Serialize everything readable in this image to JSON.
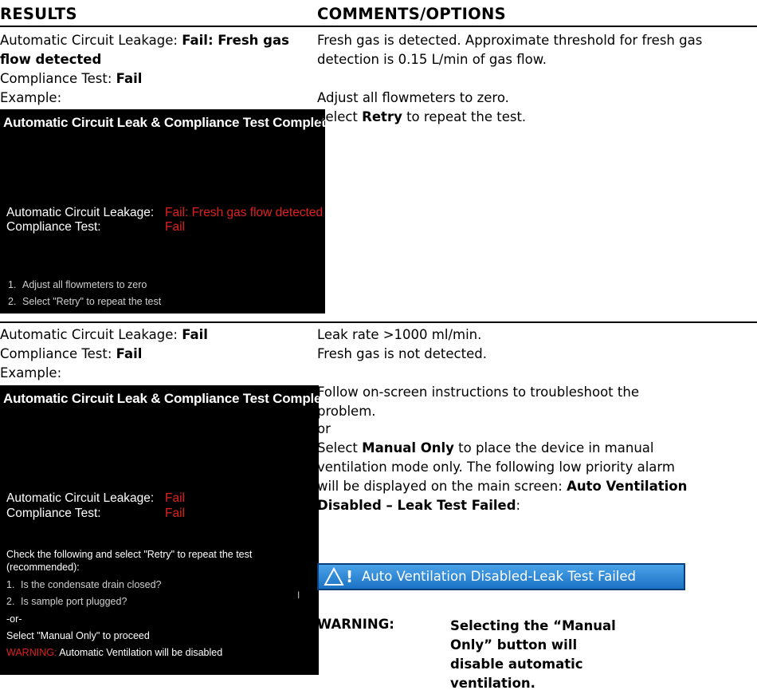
{
  "header": {
    "results": "RESULTS",
    "comments": "COMMENTS/OPTIONS"
  },
  "row1": {
    "result_line1_label": "Automatic Circuit Leakage: ",
    "result_line1_value_a": "Fail: Fresh gas",
    "result_line1_value_b": "flow detected",
    "result_line2_label": "Compliance Test: ",
    "result_line2_value": "Fail",
    "example_label": "Example:",
    "screen": {
      "title": "Automatic Circuit Leak & Compliance Test Complete",
      "leak_label": "Automatic Circuit Leakage:",
      "leak_value": "Fail: Fresh gas flow detected",
      "compliance_label": "Compliance Test:",
      "compliance_value": "Fail",
      "step1_num": "1.",
      "step1": "Adjust all flowmeters to zero",
      "step2_num": "2.",
      "step2": "Select \"Retry\" to repeat the test"
    },
    "comment_para1_a": "Fresh gas is detected. Approximate threshold for fresh gas",
    "comment_para1_b": "detection is 0.15 L/min of gas flow.",
    "comment_para2": "Adjust all flowmeters to zero.",
    "comment_para3_pre": "Select ",
    "comment_para3_bold": "Retry",
    "comment_para3_post": " to repeat the test."
  },
  "row2": {
    "result_line1_label": "Automatic Circuit Leakage: ",
    "result_line1_value": "Fail",
    "result_line2_label": "Compliance Test: ",
    "result_line2_value": "Fail",
    "example_label": "Example:",
    "screen": {
      "title": "Automatic Circuit Leak & Compliance Test Complete",
      "leak_label": "Automatic Circuit Leakage:",
      "leak_value": "Fail",
      "compliance_label": "Compliance Test:",
      "compliance_value": "Fail",
      "check_line1": "Check the following and select \"Retry\" to repeat the test",
      "check_line2": "(recommended):",
      "step1_num": "1.",
      "step1": "Is the condensate drain closed?",
      "step2_num": "2.",
      "step2": "Is sample port plugged?",
      "or": "-or-",
      "manual": "Select \"Manual Only\" to proceed",
      "warning_label": "WARNING:",
      "warning_text": " Automatic Ventilation will be disabled",
      "cursor": "I"
    },
    "comment_line1": "Leak rate >1000 ml/min.",
    "comment_line2": "Fresh gas is not detected.",
    "comment_follow_a": "Follow on-screen instructions to troubleshoot the",
    "comment_follow_b": "problem.",
    "comment_or": "or",
    "comment_select_pre": "Select ",
    "comment_select_bold": "Manual Only",
    "comment_select_post": " to place the device in manual",
    "comment_line_b": "ventilation mode only. The following low priority alarm",
    "comment_line_c_pre": "will be displayed on the main screen: ",
    "comment_line_c_bold": "Auto Ventilation",
    "comment_line_d_bold": "Disabled – Leak Test Failed",
    "comment_line_d_post": ":",
    "alarm": {
      "bang": "!",
      "message": "Auto Ventilation Disabled-Leak Test Failed"
    },
    "warning_label": "WARNING:",
    "warning_text": "Selecting the “Manual Only” button will disable automatic ventilation."
  }
}
